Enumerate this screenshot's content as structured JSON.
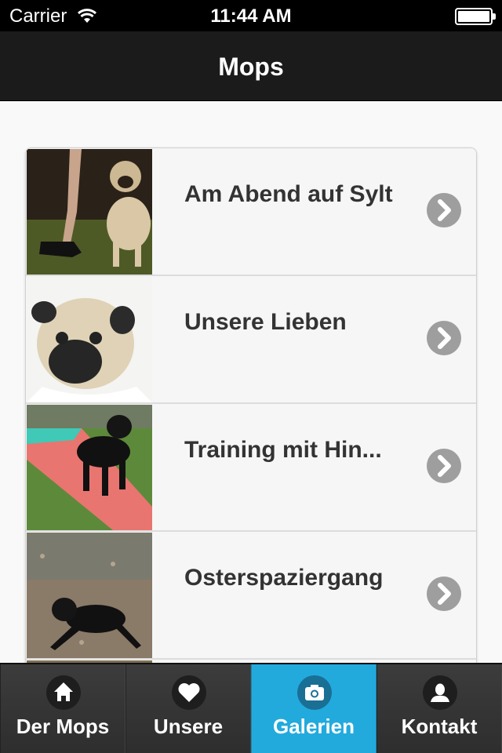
{
  "status_bar": {
    "carrier": "Carrier",
    "time": "11:44 AM"
  },
  "header": {
    "title": "Mops"
  },
  "gallery_items": [
    {
      "title": "Am Abend auf Sylt"
    },
    {
      "title": "Unsere Lieben"
    },
    {
      "title": "Training mit Hin..."
    },
    {
      "title": "Osterspaziergang"
    }
  ],
  "tabs": [
    {
      "label": "Der Mops",
      "icon": "home-icon",
      "active": false
    },
    {
      "label": "Unsere",
      "icon": "heart-icon",
      "active": false
    },
    {
      "label": "Galerien",
      "icon": "camera-icon",
      "active": true
    },
    {
      "label": "Kontakt",
      "icon": "person-icon",
      "active": false
    }
  ],
  "colors": {
    "header_bg": "#1b1b1b",
    "tab_active": "#22aadd",
    "chevron": "#9e9e9e"
  }
}
